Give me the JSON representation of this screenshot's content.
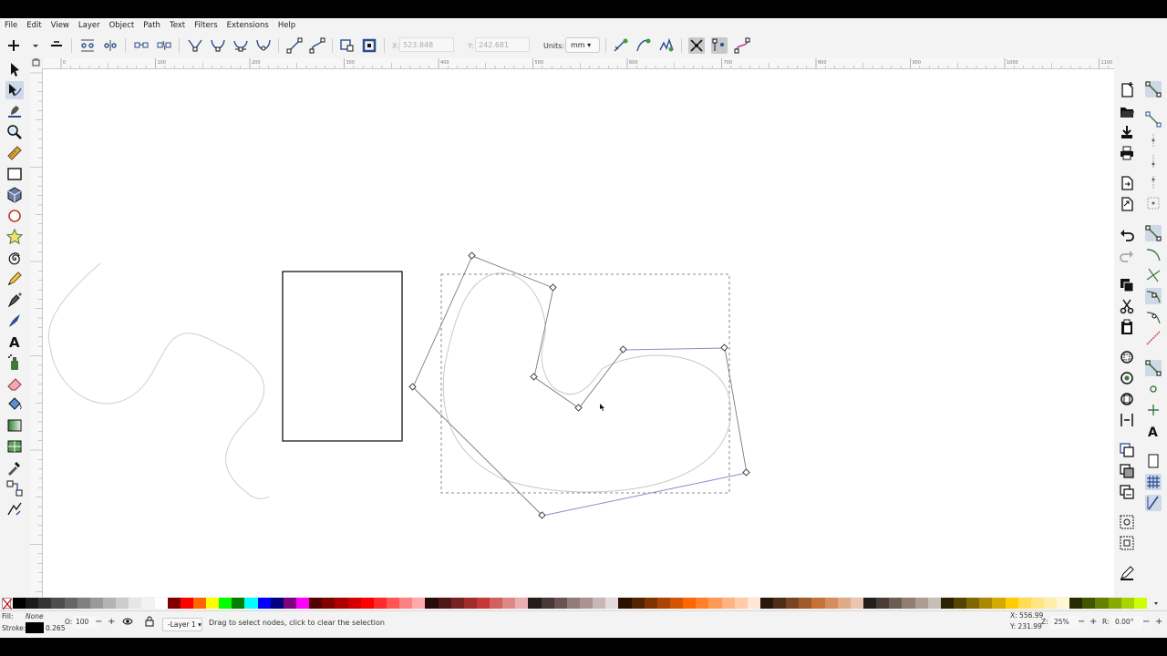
{
  "menu": [
    "File",
    "Edit",
    "View",
    "Layer",
    "Object",
    "Path",
    "Text",
    "Filters",
    "Extensions",
    "Help"
  ],
  "toolbar": {
    "x_label": "X:",
    "x_value": "523.848",
    "y_label": "Y:",
    "y_value": "242.681",
    "units_label": "Units:",
    "units_value": "mm"
  },
  "ruler_top_ticks": [
    "0",
    "100",
    "200",
    "300",
    "400",
    "500",
    "600",
    "700",
    "800",
    "900",
    "1000",
    "1100",
    "1200"
  ],
  "left_tools": [
    "selector-tool",
    "node-tool",
    "tweak-tool",
    "zoom-tool",
    "measure-tool",
    "rectangle-tool",
    "3d-box-tool",
    "ellipse-tool",
    "star-tool",
    "spiral-tool",
    "pencil-tool",
    "pen-tool",
    "calligraphy-tool",
    "text-tool",
    "spray-tool",
    "eraser-tool",
    "bucket-tool",
    "gradient-tool",
    "mesh-tool",
    "dropper-tool",
    "connector-tool",
    "lpe-tool"
  ],
  "palette_colors": [
    "#000000",
    "#1a1a1a",
    "#333333",
    "#4d4d4d",
    "#666666",
    "#808080",
    "#999999",
    "#b3b3b3",
    "#cccccc",
    "#e6e6e6",
    "#f2f2f2",
    "#ffffff",
    "#800000",
    "#ff0000",
    "#ff6600",
    "#ffff00",
    "#00ff00",
    "#008000",
    "#00ffff",
    "#0000ff",
    "#000080",
    "#800080",
    "#ff00ff",
    "#550000",
    "#800000",
    "#aa0000",
    "#d40000",
    "#ff0000",
    "#ff2a2a",
    "#ff5555",
    "#ff8080",
    "#ffaaaa",
    "#280b0b",
    "#501616",
    "#782121",
    "#a02c2c",
    "#c83737",
    "#d35f5f",
    "#de8787",
    "#e9afaf",
    "#241c1c",
    "#483737",
    "#6c5353",
    "#917c7c",
    "#ac9393",
    "#c8b7b7",
    "#e3dbdb",
    "#2b1100",
    "#552200",
    "#803300",
    "#aa4400",
    "#d45500",
    "#ff6600",
    "#ff7f2a",
    "#ff9955",
    "#ffb380",
    "#ffccaa",
    "#ffe6d5",
    "#28170b",
    "#502d16",
    "#784421",
    "#a05a2c",
    "#c87137",
    "#d38d5f",
    "#deaa87",
    "#e9c6af",
    "#241f1c",
    "#483e37",
    "#6c5d53",
    "#917c6f",
    "#ac9d93",
    "#c8beb7",
    "#2b2200",
    "#554400",
    "#806600",
    "#aa8800",
    "#d4aa00",
    "#ffcc00",
    "#ffdd55",
    "#ffe680",
    "#ffeeaa",
    "#fff6d5",
    "#282b00",
    "#445500",
    "#668000",
    "#88aa00",
    "#aad400",
    "#ccff00"
  ],
  "status": {
    "fill_label": "Fill:",
    "fill_value": "None",
    "stroke_label": "Stroke:",
    "stroke_width": "0.265",
    "opacity_label": "O:",
    "opacity_value": "100",
    "layer_value": "-Layer 1",
    "message": "Drag to select nodes, click to clear the selection",
    "cursor_x": "X: 556.99",
    "cursor_y": "Y: 231.99",
    "zoom_label": "Z:",
    "zoom_value": "25%",
    "rotation_label": "R:",
    "rotation_value": "0.00°"
  }
}
